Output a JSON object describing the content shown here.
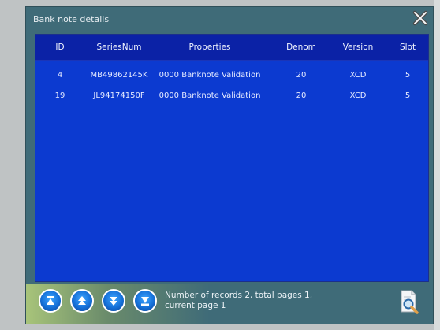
{
  "window": {
    "title": "Bank note details"
  },
  "table": {
    "headers": [
      "ID",
      "SeriesNum",
      "Properties",
      "Denom",
      "Version",
      "Slot"
    ],
    "rows": [
      {
        "id": "4",
        "series": "MB49862145K",
        "properties": "0000 Banknote Validation",
        "denom": "20",
        "version": "XCD",
        "slot": "5"
      },
      {
        "id": "19",
        "series": "JL94174150F",
        "properties": "0000 Banknote Validation",
        "denom": "20",
        "version": "XCD",
        "slot": "5"
      }
    ]
  },
  "footer": {
    "records_line1": "Number of records 2, total pages 1,",
    "records_line2": "current page 1",
    "buttons": [
      "first-page-icon",
      "previous-page-icon",
      "next-page-icon",
      "last-page-icon"
    ]
  },
  "colors": {
    "dialog_bg": "#3f6b78",
    "table_bg": "#0c3ad0",
    "header_bg": "#0b22a6",
    "button_blue": "#1570d8"
  }
}
